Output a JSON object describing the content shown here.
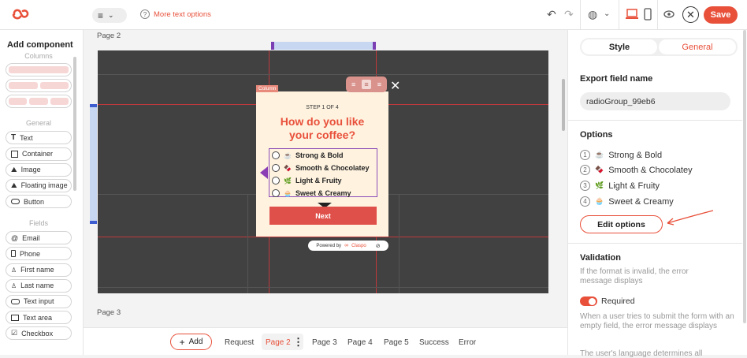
{
  "toolbar": {
    "more_text_options": "More text options",
    "save_label": "Save"
  },
  "left": {
    "title": "Add component",
    "columns_label": "Columns",
    "general_label": "General",
    "general_items": [
      {
        "label": "Text",
        "icon": "text-icon"
      },
      {
        "label": "Container",
        "icon": "container-icon"
      },
      {
        "label": "Image",
        "icon": "image-icon"
      },
      {
        "label": "Floating image",
        "icon": "floating-image-icon"
      },
      {
        "label": "Button",
        "icon": "button-icon"
      }
    ],
    "fields_label": "Fields",
    "field_items": [
      {
        "label": "Email",
        "icon": "at-icon"
      },
      {
        "label": "Phone",
        "icon": "phone-icon"
      },
      {
        "label": "First name",
        "icon": "person-icon"
      },
      {
        "label": "Last name",
        "icon": "person-icon"
      },
      {
        "label": "Text input",
        "icon": "text-input-icon"
      },
      {
        "label": "Text area",
        "icon": "text-area-icon"
      },
      {
        "label": "Checkbox",
        "icon": "checkbox-icon"
      }
    ]
  },
  "canvas": {
    "page2_label": "Page 2",
    "page3_label": "Page 3",
    "column_tag": "Column",
    "step": "STEP 1 OF 4",
    "heading": "How do you like your coffee?",
    "options": [
      "Strong & Bold",
      "Smooth & Chocolatey",
      "Light & Fruity",
      "Sweet & Creamy"
    ],
    "option_emojis": [
      "☕",
      "🍫",
      "🌿",
      "🧁"
    ],
    "next_label": "Next",
    "powered_by": "Powered by",
    "brand": "Claspo"
  },
  "right": {
    "tab_style": "Style",
    "tab_general": "General",
    "export_title": "Export field name",
    "export_value": "radioGroup_99eb6",
    "options_title": "Options",
    "options": [
      "Strong & Bold",
      "Smooth & Chocolatey",
      "Light & Fruity",
      "Sweet & Creamy"
    ],
    "option_numbers": [
      "1",
      "2",
      "3",
      "4"
    ],
    "edit_options": "Edit options",
    "validation_title": "Validation",
    "validation_desc": "If the format is invalid, the error message displays",
    "required_label": "Required",
    "required_desc": "When a user tries to submit the form with an empty field, the error message displays",
    "lang_desc": "The user's language determines all"
  },
  "bottom": {
    "add_label": "Add",
    "pages": [
      "Request",
      "Page 2",
      "Page 3",
      "Page 4",
      "Page 5",
      "Success",
      "Error"
    ]
  },
  "colors": {
    "accent": "#e8503a",
    "canvas": "#414141",
    "popup": "#fff3e0"
  }
}
